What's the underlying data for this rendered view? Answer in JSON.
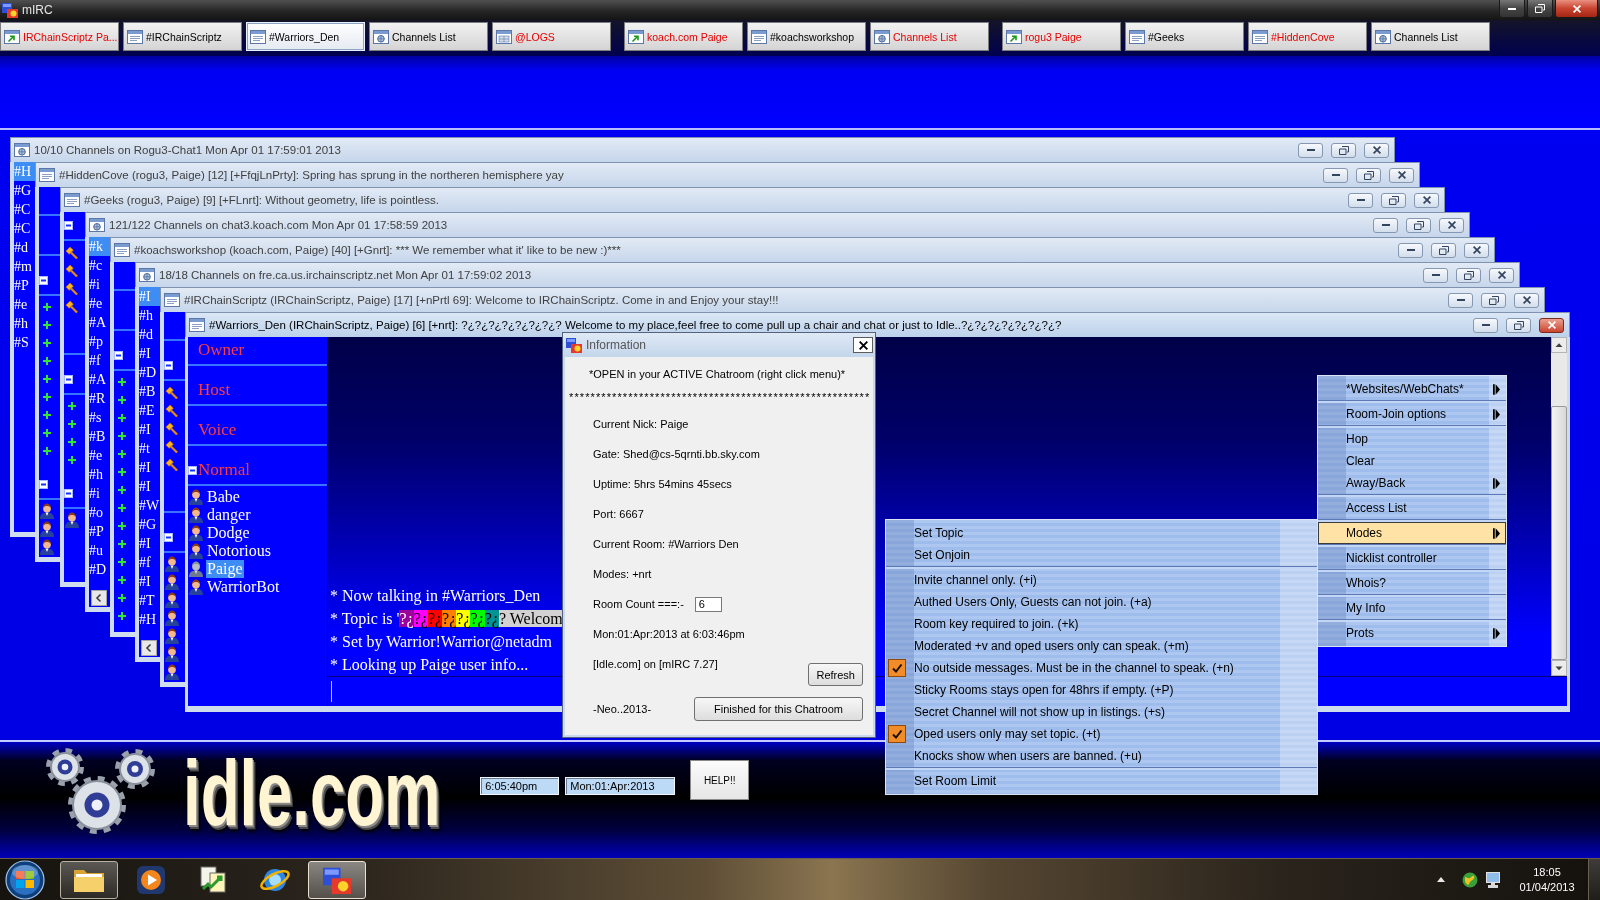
{
  "app": {
    "title": "mIRC"
  },
  "switchbar": {
    "tabs": [
      {
        "label": "IRChainScriptz Pa...",
        "kind": "status",
        "activity": true,
        "selected": false
      },
      {
        "label": "#IRChainScriptz",
        "kind": "channel",
        "activity": false,
        "selected": false
      },
      {
        "label": "#Warriors_Den",
        "kind": "channel",
        "activity": false,
        "selected": true
      },
      {
        "label": "Channels List",
        "kind": "list",
        "activity": false,
        "selected": false
      },
      {
        "label": "@LOGS",
        "kind": "custom",
        "activity": true,
        "selected": false
      },
      {
        "label": "koach.com Paige",
        "kind": "status",
        "activity": true,
        "selected": false
      },
      {
        "label": "#koachsworkshop",
        "kind": "channel",
        "activity": false,
        "selected": false
      },
      {
        "label": "Channels List",
        "kind": "list",
        "activity": true,
        "selected": false
      },
      {
        "label": "rogu3 Paige",
        "kind": "status",
        "activity": true,
        "selected": false
      },
      {
        "label": "#Geeks",
        "kind": "channel",
        "activity": false,
        "selected": false
      },
      {
        "label": "#HiddenCove",
        "kind": "channel",
        "activity": true,
        "selected": false
      },
      {
        "label": "Channels List",
        "kind": "list",
        "activity": false,
        "selected": false
      }
    ]
  },
  "windows": [
    {
      "kind": "list",
      "title": "10/10 Channels on Rogu3-Chat1 Mon Apr 01 17:59:01 2013",
      "active": false,
      "rows": [
        {
          "text": "#H",
          "selected": true
        },
        {
          "text": "#G",
          "selected": false
        },
        {
          "text": "#C",
          "selected": false
        },
        {
          "text": "#C",
          "selected": false
        },
        {
          "text": "#d",
          "selected": false
        },
        {
          "text": "#m",
          "selected": false
        },
        {
          "text": "#P",
          "selected": false
        },
        {
          "text": "#e",
          "selected": false
        },
        {
          "text": "#h",
          "selected": false
        },
        {
          "text": "#S",
          "selected": false
        }
      ]
    },
    {
      "kind": "channel",
      "title": "#HiddenCove (rogu3, Paige) [12] [+FfqjLnPrty]: Spring has sprung in the northeren hemisphere yay",
      "active": false,
      "nicklist": [
        {
          "kind": "header",
          "expanded": false
        },
        {
          "kind": "header",
          "expanded": false
        },
        {
          "kind": "header",
          "expanded": true
        },
        {
          "kind": "voice"
        },
        {
          "kind": "voice"
        },
        {
          "kind": "voice"
        },
        {
          "kind": "voice"
        },
        {
          "kind": "voice"
        },
        {
          "kind": "voice"
        },
        {
          "kind": "voice"
        },
        {
          "kind": "voice"
        },
        {
          "kind": "voice"
        },
        {
          "kind": "header",
          "expanded": true
        },
        {
          "kind": "user"
        },
        {
          "kind": "user"
        },
        {
          "kind": "user"
        }
      ]
    },
    {
      "kind": "channel",
      "title": "#Geeks (rogu3, Paige) [9] [+FLnrt]: Without geometry, life is pointless.",
      "active": false,
      "nicklist": [
        {
          "kind": "header",
          "expanded": true
        },
        {
          "kind": "op"
        },
        {
          "kind": "op"
        },
        {
          "kind": "op"
        },
        {
          "kind": "op"
        },
        {
          "kind": "header",
          "expanded": false
        },
        {
          "kind": "header",
          "expanded": true
        },
        {
          "kind": "voice"
        },
        {
          "kind": "voice"
        },
        {
          "kind": "voice"
        },
        {
          "kind": "voice"
        },
        {
          "kind": "header",
          "expanded": true
        },
        {
          "kind": "user"
        }
      ]
    },
    {
      "kind": "list",
      "title": "121/122 Channels on chat3.koach.com Mon Apr 01 17:58:59 2013",
      "active": false,
      "rows": [
        {
          "text": "#k",
          "selected": true
        },
        {
          "text": "#c",
          "selected": false
        },
        {
          "text": "#i",
          "selected": false
        },
        {
          "text": "#e",
          "selected": false
        },
        {
          "text": "#A",
          "selected": false
        },
        {
          "text": "#p",
          "selected": false
        },
        {
          "text": "#f",
          "selected": false
        },
        {
          "text": "#A",
          "selected": false
        },
        {
          "text": "#R",
          "selected": false
        },
        {
          "text": "#s",
          "selected": false
        },
        {
          "text": "#B",
          "selected": false
        },
        {
          "text": "#e",
          "selected": false
        },
        {
          "text": "#h",
          "selected": false
        },
        {
          "text": "#i",
          "selected": false
        },
        {
          "text": "#o",
          "selected": false
        },
        {
          "text": "#P",
          "selected": false
        },
        {
          "text": "#u",
          "selected": false
        },
        {
          "text": "#D",
          "selected": false
        }
      ]
    },
    {
      "kind": "channel",
      "title": "#koachsworkshop (koach.com, Paige) [40] [+Gnrt]: *** We remember what it' like to be new :)***",
      "active": false,
      "nicklist": [
        {
          "kind": "header",
          "expanded": false
        },
        {
          "kind": "header",
          "expanded": false
        },
        {
          "kind": "header",
          "expanded": true
        },
        {
          "kind": "voice"
        },
        {
          "kind": "voice"
        },
        {
          "kind": "voice"
        },
        {
          "kind": "voice"
        },
        {
          "kind": "voice"
        },
        {
          "kind": "voice"
        },
        {
          "kind": "voice"
        },
        {
          "kind": "voice"
        },
        {
          "kind": "voice"
        },
        {
          "kind": "voice"
        },
        {
          "kind": "voice"
        },
        {
          "kind": "voice"
        },
        {
          "kind": "voice"
        },
        {
          "kind": "voice"
        }
      ]
    },
    {
      "kind": "list",
      "title": "18/18 Channels on fre.ca.us.irchainscriptz.net Mon Apr 01 17:59:02 2013",
      "active": false,
      "rows": [
        {
          "text": "#I",
          "selected": true
        },
        {
          "text": "#h",
          "selected": false
        },
        {
          "text": "#d",
          "selected": false
        },
        {
          "text": "#I",
          "selected": false
        },
        {
          "text": "#D",
          "selected": false
        },
        {
          "text": "#B",
          "selected": false
        },
        {
          "text": "#E",
          "selected": false
        },
        {
          "text": "#I",
          "selected": false
        },
        {
          "text": "#t",
          "selected": false
        },
        {
          "text": "#I",
          "selected": false
        },
        {
          "text": "#I",
          "selected": false
        },
        {
          "text": "#W",
          "selected": false
        },
        {
          "text": "#G",
          "selected": false
        },
        {
          "text": "#I",
          "selected": false
        },
        {
          "text": "#f",
          "selected": false
        },
        {
          "text": "#I",
          "selected": false
        },
        {
          "text": "#T",
          "selected": false
        },
        {
          "text": "#H",
          "selected": false
        }
      ]
    },
    {
      "kind": "channel",
      "title": "#IRChainScriptz (IRChainScriptz, Paige) [17] [+nPrtl 69]: Welcome to IRChainScriptz. Come in and Enjoy your stay!!!",
      "active": false,
      "nicklist": [
        {
          "kind": "header",
          "expanded": false
        },
        {
          "kind": "header",
          "expanded": true
        },
        {
          "kind": "op"
        },
        {
          "kind": "op"
        },
        {
          "kind": "op"
        },
        {
          "kind": "op"
        },
        {
          "kind": "op"
        },
        {
          "kind": "header",
          "expanded": false
        },
        {
          "kind": "header",
          "expanded": true
        },
        {
          "kind": "user"
        },
        {
          "kind": "user"
        },
        {
          "kind": "user"
        },
        {
          "kind": "user"
        },
        {
          "kind": "user"
        },
        {
          "kind": "user"
        },
        {
          "kind": "user"
        }
      ]
    },
    {
      "kind": "channel",
      "title": "#Warriors_Den (IRChainScriptz, Paige) [6] [+nrt]: ?¿?¿?¿?¿?¿?¿?¿? Welcome to my place,feel free to come pull up a chair and chat or just to Idle..?¿?¿?¿?¿?¿?¿?¿?",
      "active": true,
      "nicklist": [
        {
          "kind": "header",
          "label": "Owner",
          "expanded": false
        },
        {
          "kind": "header",
          "label": "Host",
          "expanded": false
        },
        {
          "kind": "header",
          "label": "Voice",
          "expanded": false
        },
        {
          "kind": "header",
          "label": "Normal",
          "expanded": true
        },
        {
          "kind": "user",
          "nick": "Babe",
          "selected": false
        },
        {
          "kind": "user",
          "nick": "danger",
          "selected": false
        },
        {
          "kind": "user",
          "nick": "Dodge",
          "selected": false
        },
        {
          "kind": "user",
          "nick": "Notorious",
          "selected": false
        },
        {
          "kind": "user",
          "nick": "Paige",
          "selected": true
        },
        {
          "kind": "user",
          "nick": "WarriorBot",
          "selected": false
        }
      ],
      "messages": [
        {
          "kind": "plain",
          "text": "* Now talking in #Warriors_Den"
        },
        {
          "kind": "topic",
          "text": "* Topic is '",
          "segments": [
            {
              "text": "?¿",
              "color": "#9c009c"
            },
            {
              "text": "?¿",
              "color": "#ff00ff"
            },
            {
              "text": "?¿",
              "color": "#ff0000"
            },
            {
              "text": "?¿",
              "color": "#ff7f00"
            },
            {
              "text": "?¿",
              "color": "#ffff00"
            },
            {
              "text": "?¿",
              "color": "#00fc00"
            },
            {
              "text": "?¿",
              "color": "#009393"
            },
            {
              "text": "? Welcom",
              "color": "#d2d2d2"
            }
          ]
        },
        {
          "kind": "plain",
          "text": "* Set by Warrior!Warrior@netadm"
        },
        {
          "kind": "plain",
          "text": "* Looking up Paige user info..."
        }
      ]
    }
  ],
  "dialog": {
    "title": "Information",
    "heading": "*OPEN in your ACTIVE Chatroom (right click menu)*",
    "divider": "********************************************************",
    "rows": [
      {
        "kind": "text",
        "text": "Current Nick: Paige"
      },
      {
        "kind": "text",
        "text": "Gate: Shed@cs-5qrnti.bb.sky.com"
      },
      {
        "kind": "text",
        "text": "Uptime: 5hrs 54mins 45secs"
      },
      {
        "kind": "text",
        "text": "Port: 6667"
      },
      {
        "kind": "text",
        "text": "Current Room: #Warriors Den"
      },
      {
        "kind": "text",
        "text": "Modes: +nrt"
      },
      {
        "kind": "field",
        "label": "Room Count ===:-",
        "value": "6"
      },
      {
        "kind": "text",
        "text": "Mon:01:Apr:2013 at 6:03:46pm"
      },
      {
        "kind": "action",
        "text": "[Idle.com] on [mIRC 7.27]",
        "button": "Refresh"
      },
      {
        "kind": "action",
        "text": "-Neo..2013-",
        "button": "Finished for this Chatroom"
      }
    ]
  },
  "context_menu": {
    "items": [
      {
        "kind": "item",
        "label": "*Websites/WebChats*",
        "submenu": true,
        "selected": false
      },
      {
        "kind": "separator"
      },
      {
        "kind": "item",
        "label": "Room-Join options",
        "submenu": true,
        "selected": false
      },
      {
        "kind": "separator"
      },
      {
        "kind": "item",
        "label": "Hop",
        "submenu": false,
        "selected": false
      },
      {
        "kind": "item",
        "label": "Clear",
        "submenu": false,
        "selected": false
      },
      {
        "kind": "item",
        "label": "Away/Back",
        "submenu": true,
        "selected": false
      },
      {
        "kind": "separator"
      },
      {
        "kind": "item",
        "label": "Access List",
        "submenu": false,
        "selected": false
      },
      {
        "kind": "separator"
      },
      {
        "kind": "item",
        "label": "Modes",
        "submenu": true,
        "selected": true
      },
      {
        "kind": "separator"
      },
      {
        "kind": "item",
        "label": "Nicklist controller",
        "submenu": false,
        "selected": false
      },
      {
        "kind": "separator"
      },
      {
        "kind": "item",
        "label": "Whois?",
        "submenu": false,
        "selected": false
      },
      {
        "kind": "separator"
      },
      {
        "kind": "item",
        "label": "My Info",
        "submenu": false,
        "selected": false
      },
      {
        "kind": "separator"
      },
      {
        "kind": "item",
        "label": "Prots",
        "submenu": true,
        "selected": false
      }
    ]
  },
  "modes_submenu": {
    "items": [
      {
        "kind": "item",
        "label": "Set Topic",
        "checked": false,
        "selected": false
      },
      {
        "kind": "item",
        "label": "Set Onjoin",
        "checked": false,
        "selected": false
      },
      {
        "kind": "separator"
      },
      {
        "kind": "item",
        "label": "Invite channel only. (+i)",
        "checked": false,
        "selected": false
      },
      {
        "kind": "item",
        "label": "Authed Users Only, Guests can not join. (+a)",
        "checked": false,
        "selected": false
      },
      {
        "kind": "item",
        "label": "Room key required to join. (+k)",
        "checked": false,
        "selected": false
      },
      {
        "kind": "item",
        "label": "Moderated +v and oped users only can speak. (+m)",
        "checked": false,
        "selected": false
      },
      {
        "kind": "item",
        "label": "No outside messages. Must be in the channel to speak. (+n)",
        "checked": true,
        "selected": false
      },
      {
        "kind": "item",
        "label": "Sticky Rooms stays open for 48hrs if empty. (+P)",
        "checked": false,
        "selected": false
      },
      {
        "kind": "item",
        "label": "Secret Channel will not show up in listings. (+s)",
        "checked": false,
        "selected": false
      },
      {
        "kind": "item",
        "label": "Oped users only may set topic. (+t)",
        "checked": true,
        "selected": false
      },
      {
        "kind": "item",
        "label": "Knocks show when users are banned. (+u)",
        "checked": false,
        "selected": false
      },
      {
        "kind": "separator"
      },
      {
        "kind": "item",
        "label": "Set Room Limit",
        "checked": false,
        "selected": false
      }
    ]
  },
  "banner": {
    "logo": "idle.com",
    "time": "6:05:40pm",
    "date": "Mon:01:Apr:2013",
    "help_button": "HELP!!"
  },
  "taskbar": {
    "items": [
      {
        "kind": "explorer",
        "running": true,
        "active": false
      },
      {
        "kind": "media",
        "running": false,
        "active": false
      },
      {
        "kind": "transfer",
        "running": false,
        "active": false
      },
      {
        "kind": "browser",
        "running": false,
        "active": false
      },
      {
        "kind": "mirc",
        "running": true,
        "active": true
      }
    ],
    "clock": {
      "time": "18:05",
      "date": "01/04/2013"
    }
  }
}
